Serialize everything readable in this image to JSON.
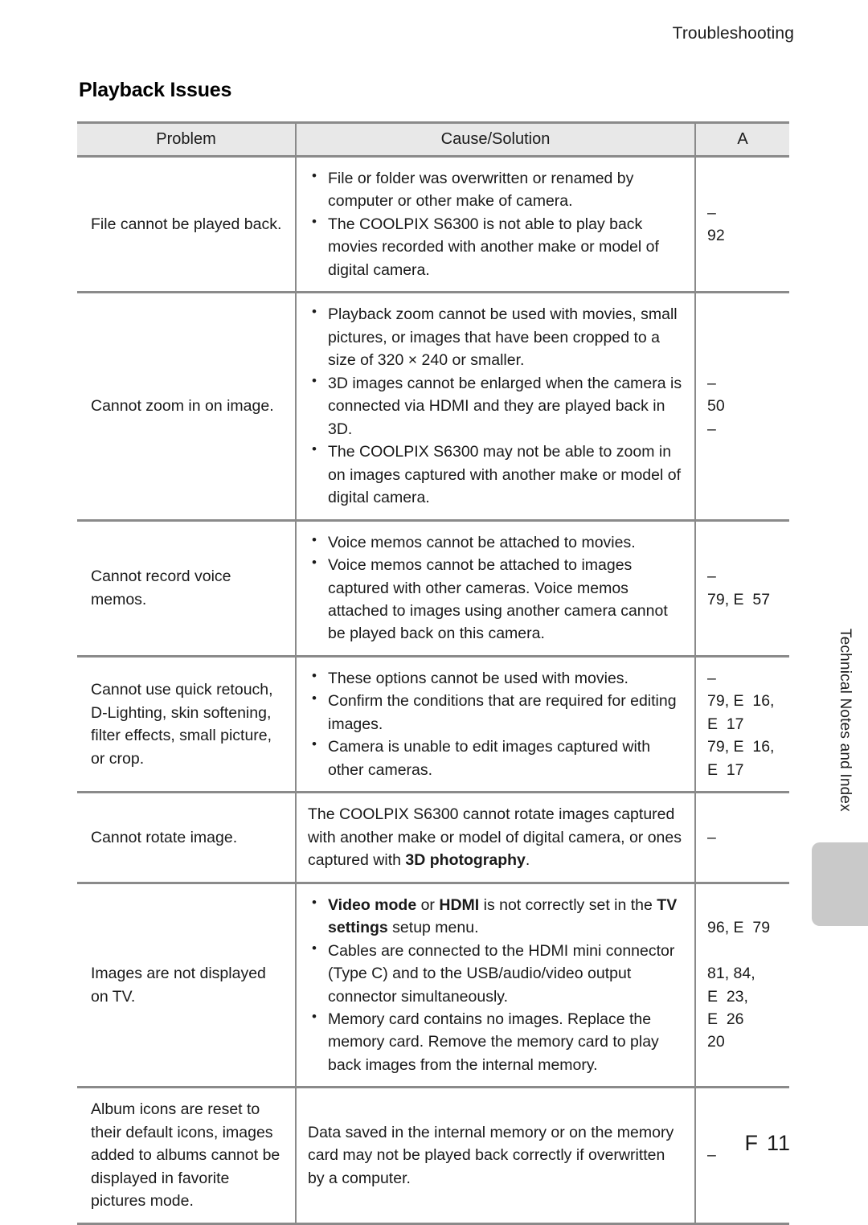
{
  "header": {
    "running_header": "Troubleshooting"
  },
  "page_title": "Playback Issues",
  "table": {
    "columns": [
      "Problem",
      "Cause/Solution",
      "A"
    ],
    "rows": [
      {
        "problem": "File cannot be played back.",
        "bulleted": true,
        "items": [
          "File or folder was overwritten or renamed by computer or other make of camera.",
          "The COOLPIX S6300 is not able to play back movies recorded with another make or model of digital camera."
        ],
        "refs": [
          "–",
          "92"
        ]
      },
      {
        "problem": "Cannot zoom in on image.",
        "bulleted": true,
        "items": [
          "Playback zoom cannot be used with movies, small pictures, or images that have been cropped to a size of 320 × 240 or smaller.",
          "3D images cannot be enlarged when the camera is connected via HDMI and they are played back in 3D.",
          "The COOLPIX S6300 may not be able to zoom in on images captured with another make or model of digital camera."
        ],
        "refs": [
          "–",
          "50",
          "–"
        ]
      },
      {
        "problem": "Cannot record voice memos.",
        "bulleted": true,
        "items": [
          "Voice memos cannot be attached to movies.",
          "Voice memos cannot be attached to images captured with other cameras. Voice memos attached to images using another camera cannot be played back on this camera."
        ],
        "refs": [
          "–",
          "79, E  57"
        ]
      },
      {
        "problem": "Cannot use quick retouch, D-Lighting, skin softening, filter effects, small picture, or crop.",
        "bulleted": true,
        "items": [
          "These options cannot be used with movies.",
          "Confirm the conditions that are required for editing images.",
          "Camera is unable to edit images captured with other cameras."
        ],
        "refs": [
          "–",
          "79, E  16,",
          "E  17",
          "79, E  16,",
          "E  17"
        ]
      },
      {
        "problem": "Cannot rotate image.",
        "bulleted": false,
        "items": [
          "The COOLPIX S6300 cannot rotate images captured with another make or model of digital camera, or ones captured with 3D photography."
        ],
        "items_html": [
          "The COOLPIX S6300 cannot rotate images captured with another make or model of digital camera, or ones captured with <b>3D photography</b>."
        ],
        "refs": [
          "–"
        ]
      },
      {
        "problem": "Images are not displayed on TV.",
        "bulleted": true,
        "items": [
          "Video mode or HDMI is not correctly set in the TV settings setup menu.",
          "Cables are connected to the HDMI mini connector (Type C) and to the USB/audio/video output connector simultaneously.",
          "Memory card contains no images. Replace the memory card. Remove the memory card to play back images from the internal memory."
        ],
        "items_html": [
          "<b>Video mode</b> or <b>HDMI</b> is not correctly set in the <b>TV settings</b> setup menu.",
          "Cables are connected to the HDMI mini connector (Type C) and to the USB/audio/video output connector simultaneously.",
          "Memory card contains no images. Replace the memory card. Remove the memory card to play back images from the internal memory."
        ],
        "refs": [
          "96, E  79",
          "",
          "81, 84,",
          "E  23,",
          "E  26",
          "20"
        ]
      },
      {
        "problem": "Album icons are reset to their default icons, images added to albums cannot be displayed in favorite pictures mode.",
        "bulleted": false,
        "items": [
          "Data saved in the internal memory or on the memory card may not be played back correctly if overwritten by a computer."
        ],
        "refs": [
          "–"
        ]
      }
    ]
  },
  "side_tab": {
    "vertical_label": "Technical Notes and Index"
  },
  "footer": {
    "symbol": "F",
    "page_number": "11"
  }
}
